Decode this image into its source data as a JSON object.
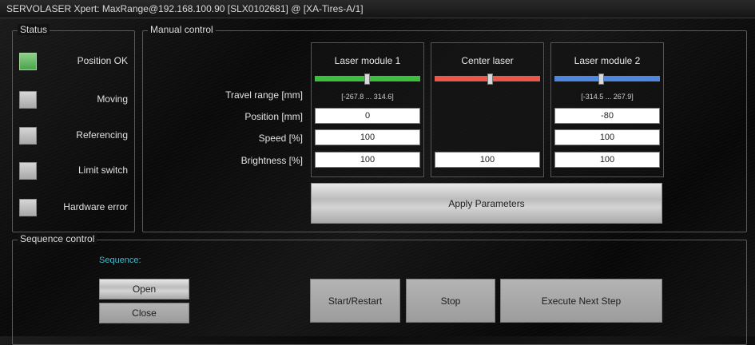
{
  "window": {
    "title": "SERVOLASER Xpert: MaxRange@192.168.100.90 [SLX0102681] @ [XA-Tires-A/1]"
  },
  "status": {
    "label": "Status",
    "items": [
      {
        "label": "Position OK",
        "active": true
      },
      {
        "label": "Moving",
        "active": false
      },
      {
        "label": "Referencing",
        "active": false
      },
      {
        "label": "Limit switch",
        "active": false
      },
      {
        "label": "Hardware error",
        "active": false
      }
    ]
  },
  "manual": {
    "label": "Manual control",
    "row_labels": {
      "travel": "Travel range [mm]",
      "position": "Position [mm]",
      "speed": "Speed [%]",
      "brightness": "Brightness [%]"
    },
    "modules": [
      {
        "title": "Laser module 1",
        "color": "#3cbf3c",
        "slider_value": 0.47,
        "range": "[-267.8 ... 314.6]",
        "position": "0",
        "speed": "100",
        "brightness": "100"
      },
      {
        "title": "Center laser",
        "color": "#e8574a",
        "slider_value": 0.5,
        "brightness": "100"
      },
      {
        "title": "Laser module 2",
        "color": "#4f86e0",
        "slider_value": 0.42,
        "range": "[-314.5 ... 267.9]",
        "position": "-80",
        "speed": "100",
        "brightness": "100"
      }
    ],
    "apply_label": "Apply Parameters"
  },
  "sequence": {
    "label": "Sequence control",
    "sequence_label": "Sequence:",
    "open_label": "Open",
    "close_label": "Close",
    "start_label": "Start/Restart",
    "stop_label": "Stop",
    "next_label": "Execute Next Step"
  }
}
